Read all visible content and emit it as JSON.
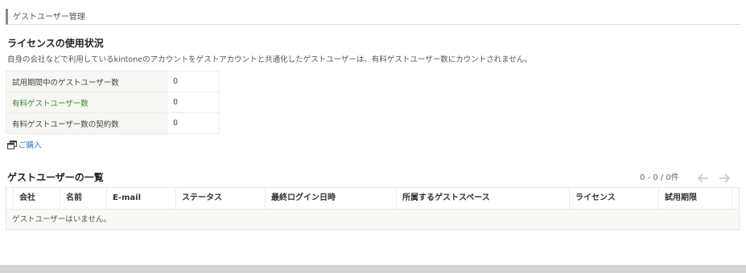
{
  "header": {
    "title": "ゲストユーザー管理"
  },
  "license": {
    "title": "ライセンスの使用状況",
    "description": "自身の会社などで利用しているkintoneのアカウントをゲストアカウントと共通化したゲストユーザーは、有料ゲストユーザー数にカウントされません。",
    "rows": [
      {
        "label": "試用期間中のゲストユーザー数",
        "value": "0"
      },
      {
        "label": "有料ゲストユーザー数",
        "value": "0"
      },
      {
        "label": "有料ゲストユーザー数の契約数",
        "value": "0"
      }
    ],
    "purchase_label": "ご購入",
    "purchase_icon": "new-window-icon"
  },
  "guest_list": {
    "title": "ゲストユーザーの一覧",
    "pager": {
      "text": "0 - 0 / 0件",
      "prev_icon": "arrow-left-icon",
      "next_icon": "arrow-right-icon"
    },
    "columns": [
      "会社",
      "名前",
      "E-mail",
      "ステータス",
      "最終ログイン日時",
      "所属するゲストスペース",
      "ライセンス",
      "試用期限"
    ],
    "empty_message": "ゲストユーザーはいません。"
  },
  "colors": {
    "link_green": "#3b8a2e",
    "link_blue": "#3a78b8",
    "row_bg": "#f6f6f3"
  }
}
